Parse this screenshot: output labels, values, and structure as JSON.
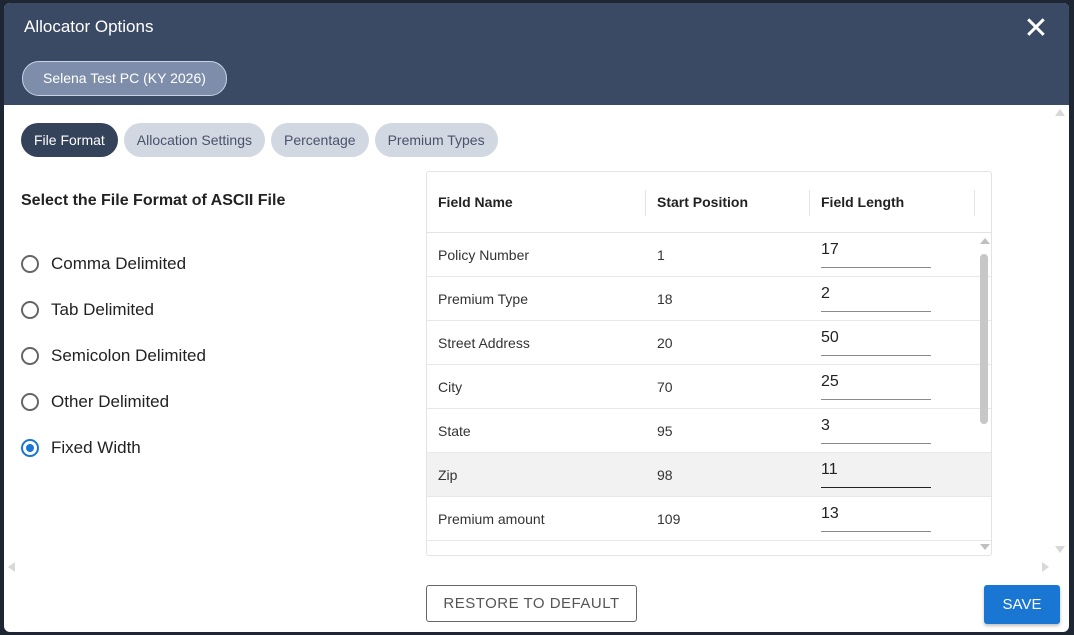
{
  "dialog": {
    "title": "Allocator Options",
    "close_icon": "close-icon",
    "company_chip": "Selena Test PC (KY 2026)"
  },
  "tabs": [
    {
      "label": "File Format",
      "active": true
    },
    {
      "label": "Allocation Settings",
      "active": false
    },
    {
      "label": "Percentage",
      "active": false
    },
    {
      "label": "Premium Types",
      "active": false
    }
  ],
  "file_format": {
    "heading": "Select the File Format of ASCII File",
    "options": [
      {
        "label": "Comma Delimited",
        "selected": false
      },
      {
        "label": "Tab Delimited",
        "selected": false
      },
      {
        "label": "Semicolon Delimited",
        "selected": false
      },
      {
        "label": "Other Delimited",
        "selected": false
      },
      {
        "label": "Fixed Width",
        "selected": true
      }
    ]
  },
  "table": {
    "headers": [
      "Field Name",
      "Start Position",
      "Field Length"
    ],
    "rows": [
      {
        "field_name": "Policy Number",
        "start": "1",
        "length": "17"
      },
      {
        "field_name": "Premium Type",
        "start": "18",
        "length": "2"
      },
      {
        "field_name": "Street Address",
        "start": "20",
        "length": "50"
      },
      {
        "field_name": "City",
        "start": "70",
        "length": "25"
      },
      {
        "field_name": "State",
        "start": "95",
        "length": "3"
      },
      {
        "field_name": "Zip",
        "start": "98",
        "length": "11"
      },
      {
        "field_name": "Premium amount",
        "start": "109",
        "length": "13"
      }
    ]
  },
  "buttons": {
    "restore": "RESTORE TO DEFAULT",
    "save": "SAVE"
  },
  "colors": {
    "header": "#3a4a65",
    "accent": "#1976d2",
    "active_tab": "#34425a"
  }
}
